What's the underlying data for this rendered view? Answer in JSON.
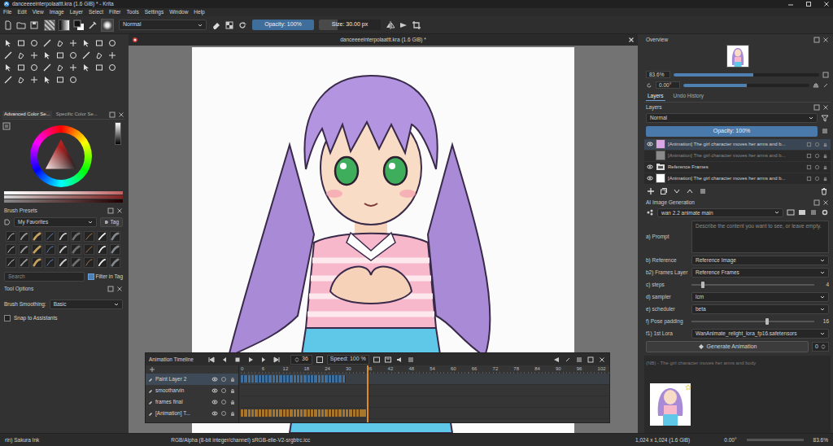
{
  "window": {
    "title": "danceeeeinterpolaattt.kra (1.6 GiB) * - Krita"
  },
  "menu": [
    "File",
    "Edit",
    "View",
    "Image",
    "Layer",
    "Select",
    "Filter",
    "Tools",
    "Settings",
    "Window",
    "Help"
  ],
  "toolbar": {
    "blend_mode": "Normal",
    "opacity": {
      "label": "Opacity: 100%",
      "level": 1
    },
    "size": {
      "label": "Size: 30.00 px",
      "level": 0.3
    }
  },
  "document": {
    "title": "danceeeeinterpolaattt.kra (1.6 GiB) *"
  },
  "color_selector": {
    "tabs": [
      {
        "label": "Advanced Color Se...",
        "selected": true
      },
      {
        "label": "Specific Color Se...",
        "selected": false
      }
    ]
  },
  "brush_presets": {
    "title": "Brush Presets",
    "tag_group": "My Favorites",
    "tag_button": "Tag",
    "search_placeholder": "Search",
    "filter_in_tag": {
      "label": "Filter in Tag",
      "checked": true
    }
  },
  "tool_options": {
    "title": "Tool Options",
    "smoothing_label": "Brush Smoothing:",
    "smoothing_value": "Basic",
    "snap": {
      "label": "Snap to Assistants",
      "checked": false
    }
  },
  "timeline": {
    "title": "Animation Timeline",
    "current_frame": "36",
    "speed": "Speed: 100 %",
    "ruler": [
      "0",
      "6",
      "12",
      "18",
      "24",
      "30",
      "36",
      "42",
      "48",
      "54",
      "60",
      "66",
      "72",
      "78",
      "84",
      "90",
      "96",
      "102"
    ],
    "layers": [
      {
        "name": "Paint Layer 2",
        "selected": true,
        "frames": [
          0,
          29
        ],
        "color": "#3f6f9f"
      },
      {
        "name": "smootharvin",
        "selected": false,
        "frames": null
      },
      {
        "name": "frames final",
        "selected": false,
        "frames": null
      },
      {
        "name": "[Animation] T...",
        "selected": false,
        "frames": [
          0,
          35
        ],
        "color": "#a8772c"
      }
    ]
  },
  "overview": {
    "title": "Overview",
    "zoom": "83.6%",
    "zoom_level": 0.55,
    "rotation": "0.00°",
    "rotation_level": 0.5
  },
  "layers_docker": {
    "tabs": [
      {
        "label": "Layers",
        "selected": true
      },
      {
        "label": "Undo History",
        "selected": false
      }
    ],
    "title": "Layers",
    "blend_mode": "Normal",
    "opacity": {
      "label": "Opacity: 100%",
      "level": 1
    },
    "layers": [
      {
        "name": "[Animation] The girl character moves her arms and b...",
        "kind": "paint",
        "color": "#d9a6e6",
        "visible": true,
        "greyed": false,
        "selected": true
      },
      {
        "name": "[Animation] The girl character moves her arms and b...",
        "kind": "paint",
        "color": "#8a8a8a",
        "visible": false,
        "greyed": true,
        "selected": false
      },
      {
        "name": "Reference Frames",
        "kind": "group",
        "color": "#dddddd",
        "visible": true,
        "greyed": false,
        "selected": false
      },
      {
        "name": "[Animation] The girl character moves her arms and b...",
        "kind": "paint",
        "color": "#ffffff",
        "visible": true,
        "greyed": false,
        "selected": false
      }
    ]
  },
  "ai": {
    "title": "AI Image Generation",
    "workspace": "wan 2.2 animate main",
    "prompt": {
      "label": "a) Prompt",
      "placeholder": "Describe the content you want to see, or leave empty."
    },
    "params": [
      {
        "kind": "select",
        "label": "b) Reference",
        "value": "Reference Image"
      },
      {
        "kind": "select",
        "label": "b2) Frames Layer",
        "value": "Reference Frames"
      },
      {
        "kind": "slider",
        "label": "c) steps",
        "value": "4",
        "level": 0.08
      },
      {
        "kind": "select",
        "label": "d) sampler",
        "value": "lcm"
      },
      {
        "kind": "select",
        "label": "e) scheduler",
        "value": "beta"
      },
      {
        "kind": "slider",
        "label": "f) Pose padding",
        "value": "16",
        "level": 0.6
      },
      {
        "kind": "select",
        "label": "f1) 1st Lora",
        "value": "WanAnimate_relight_lora_fp16.safetensors"
      }
    ],
    "generate": "Generate Animation",
    "count": "0",
    "history": {
      "caption": "(NB) - The girl character moves her arms and body"
    }
  },
  "status_bar": {
    "brush": "rin) Sakura Ink",
    "color_profile": "RGB/Alpha (8-bit integer/channel) sRGB-elle-V2-srgbtrc.icc",
    "size": "1,024 x 1,024 (1.6 GiB)",
    "rotation": "0.00°",
    "zoom": "83.6%"
  }
}
